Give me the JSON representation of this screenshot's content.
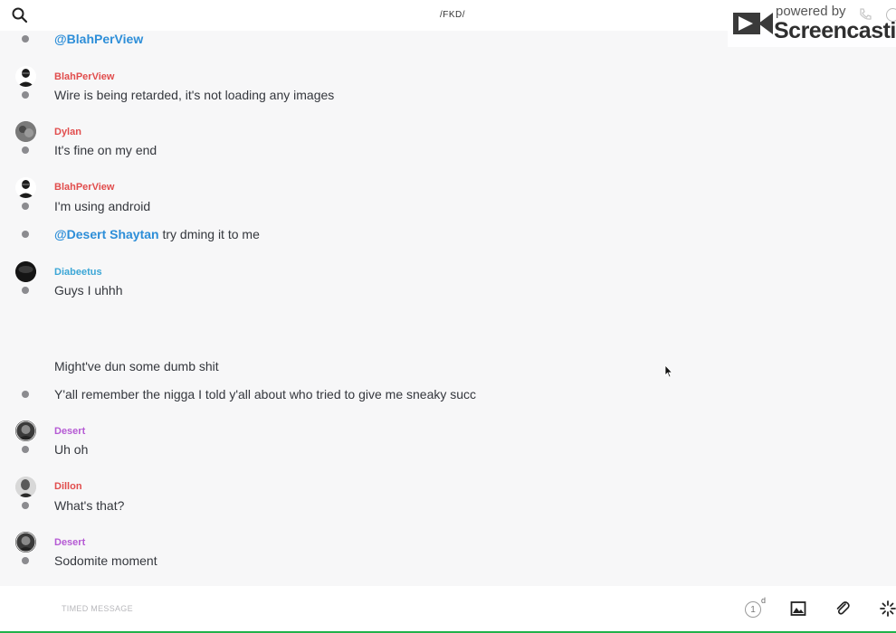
{
  "header": {
    "title": "/FKD/",
    "watermark": {
      "powered": "powered by",
      "brand": "Screencastify"
    }
  },
  "colors": {
    "mention": "#2d8ed8",
    "sender_red": "#e14d4d",
    "sender_blue": "#3ba6d6",
    "sender_purple": "#b55ad4",
    "dot": "#8b8b8f"
  },
  "messages": [
    {
      "mention": "@BlahPerView",
      "text": ""
    },
    {
      "sender": "BlahPerView",
      "text": "Wire is being retarded, it's not loading any images"
    },
    {
      "sender": "Dylan",
      "text": "It's fine on my end"
    },
    {
      "sender": "BlahPerView",
      "text": "I'm using android"
    },
    {
      "mention": "@Desert Shaytan",
      "text": " try dming it to me"
    },
    {
      "sender": "Diabeetus",
      "text": "Guys I uhhh"
    },
    {
      "text": "Might've dun some dumb shit"
    },
    {
      "text": "Y'all remember the nigga I told y'all about who tried to give me sneaky succ"
    },
    {
      "sender": "Desert",
      "text": "Uh oh"
    },
    {
      "sender": "Dillon",
      "text": "What's that?"
    },
    {
      "sender": "Desert",
      "text": "Sodomite moment"
    }
  ],
  "composer": {
    "placeholder": "TIMED MESSAGE",
    "timer_value": "1",
    "timer_unit": "d"
  },
  "icons": {
    "search": "search-icon",
    "call": "phone-icon",
    "info": "info-icon",
    "timer": "timer-icon",
    "image": "image-icon",
    "attach": "paperclip-icon",
    "ping": "ping-icon"
  }
}
